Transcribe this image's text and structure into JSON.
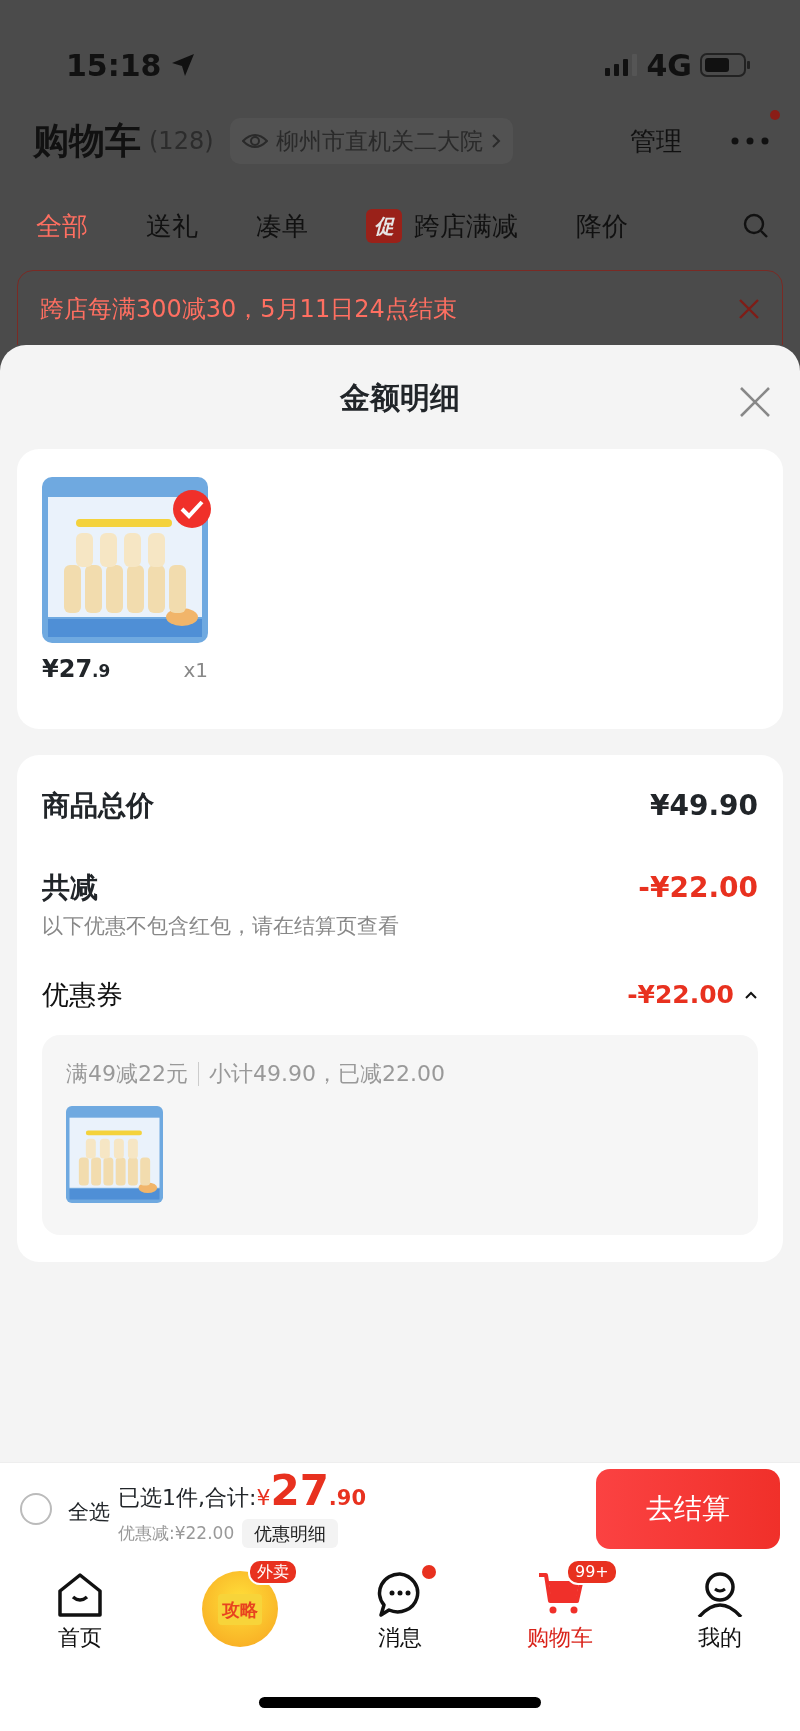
{
  "status_bar": {
    "time": "15:18",
    "network": "4G"
  },
  "header": {
    "title": "购物车",
    "count": "(128)",
    "location": "柳州市直机关二大院",
    "manage": "管理",
    "has_notification": true
  },
  "tabs": [
    {
      "label": "全部",
      "selected": true
    },
    {
      "label": "送礼",
      "selected": false
    },
    {
      "label": "凑单",
      "selected": false
    },
    {
      "label": "跨店满减",
      "badge": "促",
      "selected": false
    },
    {
      "label": "降价",
      "selected": false
    }
  ],
  "promo_banner": {
    "text": "跨店每满300减30，5月11日24点结束"
  },
  "sheet": {
    "title": "金额明细",
    "items": [
      {
        "kind": "picture",
        "price": "¥27",
        "price_fraction": ".9",
        "quantity": "x1",
        "checked": true
      }
    ],
    "totals": {
      "goods_label": "商品总价",
      "goods_value": "¥49.90",
      "discount_label": "共减",
      "discount_value": "-¥22.00",
      "discount_note": "以下优惠不包含红包，请在结算页查看",
      "coupon_label": "优惠券",
      "coupon_value": "-¥22.00",
      "coupon_expanded": true,
      "coupon_detail": {
        "rule": "满49减22元",
        "subtotal": "小计49.90，已减22.00"
      }
    }
  },
  "checkout_bar": {
    "select_all_label": "全选",
    "select_all_checked": false,
    "selected_text": "已选1件,合计:",
    "currency": "¥",
    "total": "27",
    "total_fraction": ".90",
    "discount_text": "优惠减:¥22.00",
    "detail_button": "优惠明细",
    "checkout_button": "去结算"
  },
  "bottom_nav": [
    {
      "kind": "home",
      "label": "首页",
      "selected": false
    },
    {
      "kind": "promo",
      "icon_text": "攻略",
      "badge": "外卖",
      "selected": false
    },
    {
      "kind": "messages",
      "label": "消息",
      "has_dot": true,
      "selected": false
    },
    {
      "kind": "cart",
      "label": "购物车",
      "badge": "99+",
      "selected": true
    },
    {
      "kind": "profile",
      "label": "我的",
      "selected": false
    }
  ]
}
